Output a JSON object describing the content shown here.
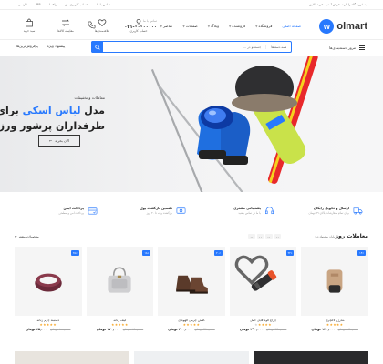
{
  "topbar": {
    "promo": "به فروشگاه ولمارت خوش آمدید. خرید آنلاین",
    "links": [
      "تماس با ما",
      "حساب کاربری من",
      "راهنما",
      "IRR",
      "فارسی"
    ]
  },
  "header": {
    "logo_text": "olmart",
    "logo_mark": "w",
    "nav": [
      {
        "label": "صفحه اصلی",
        "active": true
      },
      {
        "label": "فروشگاه",
        "caret": true
      },
      {
        "label": "فروشنده",
        "caret": true
      },
      {
        "label": "وبلاگ",
        "caret": true
      },
      {
        "label": "صفحات",
        "caret": true
      },
      {
        "label": "عناصر",
        "caret": true
      }
    ],
    "phone_label": "تماس با ما",
    "phone_number": "۰۲۱-۰۰۰۰۰۰۰۰",
    "icons": [
      {
        "label": "حساب کاربری",
        "icon": "user-icon"
      },
      {
        "label": "علاقه‌مندی‌ها",
        "icon": "heart-icon"
      },
      {
        "label": "مقایسه کالاها",
        "icon": "compare-icon"
      },
      {
        "label": "سبد خرید",
        "icon": "bag-icon"
      }
    ]
  },
  "search": {
    "category_button": "مرور دسته‌بندی‌ها",
    "placeholder": "جستجو در ...",
    "category_select": "همه دسته‌ها",
    "links": [
      "پیشنهاد ویژه",
      "پرفروش‌ترین‌ها"
    ]
  },
  "hero": {
    "subtitle": "معاملات و تخفیفات",
    "title_part1": "مدل ",
    "title_highlight": "لباس اسکی",
    "title_part2": " برای طرفداران پرشور ورزش",
    "button": "الان بخرید"
  },
  "features": [
    {
      "icon": "truck-icon",
      "title": "ارسال و تحویل رایگان",
      "desc": "برای تمام سفارشات بالای ۹۹ تومان"
    },
    {
      "icon": "support-icon",
      "title": "پشتیبانی مشتری",
      "desc": "با ما در تماس باشید"
    },
    {
      "icon": "money-back-icon",
      "title": "تضمین بازگشت پول",
      "desc": "بازگشت وجه تا ۳۰ روز"
    },
    {
      "icon": "secure-payment-icon",
      "title": "پرداخت ایمن",
      "desc": "پرداخت امن و مطمئن"
    }
  ],
  "deals": {
    "title": "معاملات روز",
    "ends_label": "پایان پیشنهاد در:",
    "timer": [
      "۰۰",
      "۰۰",
      "۰۰",
      "۰۰"
    ],
    "view_all": "محصولات بیشتر"
  },
  "products": [
    {
      "name": "شارژر لاکچری",
      "badge": "۱۴٪",
      "image": "charger-icon",
      "stars": 5,
      "old_price": "۱۴۰٫۰۰۰ تومان",
      "new_price": "۱۲۰٫۰۰۰ تومان"
    },
    {
      "name": "چراغ قوه قابل حمل",
      "badge": "۲۴٪",
      "image": "flashlight-icon",
      "stars": 4,
      "old_price": "۳۵۰٫۰۰۰ تومان",
      "new_price": "۲۹۰٫۰۰۰ تومان"
    },
    {
      "name": "کفش چرمی قهوه‌ای",
      "badge": "۲۰٪",
      "image": "shoes-icon",
      "stars": 5,
      "old_price": "۲۵۰٫۰۰۰ تومان",
      "new_price": "۲۰۰٫۰۰۰ تومان"
    },
    {
      "name": "کیف زنانه",
      "badge": "۱۸٪",
      "image": "handbag-icon",
      "stars": 5,
      "old_price": "۱۹۰٫۰۰۰ تومان",
      "new_price": "۱۷۰٫۰۰۰ تومان"
    },
    {
      "name": "دستبند چرم زنانه",
      "badge": "۲۵٪",
      "image": "bracelet-icon",
      "stars": 5,
      "old_price": "۱۰۰٫۰۰۰ تومان",
      "new_price": "۷۵٫۰۰۰ تومان"
    }
  ],
  "colors": {
    "accent": "#2879fe",
    "star": "#f7a21b"
  }
}
